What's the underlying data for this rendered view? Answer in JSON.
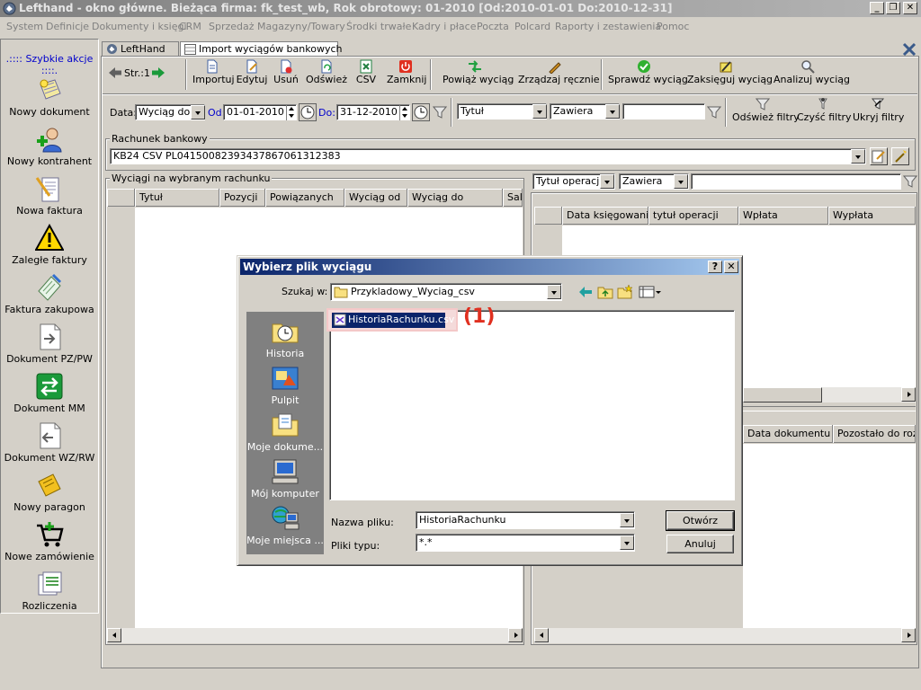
{
  "window": {
    "title": "Lefthand - okno główne. Bieżąca firma: fk_test_wb, Rok obrotowy: 01-2010 [Od:2010-01-01 Do:2010-12-31]",
    "minimize": "_",
    "maximize": "❐",
    "close": "✕"
  },
  "menu": [
    "System",
    "Definicje",
    "Dokumenty i księgi",
    "CRM",
    "Sprzedaż",
    "Magazyny/Towary",
    "Środki trwałe",
    "Kadry i płace",
    "Poczta",
    "Polcard",
    "Raporty i zestawienia",
    "Pomoc"
  ],
  "sidebar": {
    "header": ".:::: Szybkie akcje ::::.",
    "items": [
      {
        "label": "Nowy dokument",
        "icon": "new-document-icon"
      },
      {
        "label": "Nowy kontrahent",
        "icon": "new-contractor-icon"
      },
      {
        "label": "Nowa faktura",
        "icon": "new-invoice-icon"
      },
      {
        "label": "Zaległe faktury",
        "icon": "warning-icon"
      },
      {
        "label": "Faktura zakupowa",
        "icon": "purchase-invoice-icon"
      },
      {
        "label": "Dokument PZ/PW",
        "icon": "document-pz-icon"
      },
      {
        "label": "Dokument MM",
        "icon": "transfer-icon"
      },
      {
        "label": "Dokument WZ/RW",
        "icon": "document-wz-icon"
      },
      {
        "label": "Nowy paragon",
        "icon": "receipt-icon"
      },
      {
        "label": "Nowe zamówienie",
        "icon": "cart-icon"
      },
      {
        "label": "Rozliczenia",
        "icon": "settlements-icon"
      }
    ]
  },
  "tabs": [
    {
      "label": "LeftHand",
      "active": false
    },
    {
      "label": "Import wyciągów bankowych",
      "active": true
    }
  ],
  "toolbar": {
    "page_label": "Str.:1",
    "buttons": [
      "Importuj",
      "Edytuj",
      "Usuń",
      "Odśwież",
      "CSV",
      "Zamknij",
      "Powiąż wyciąg",
      "Zrządzaj ręcznie",
      "Sprawdź wyciąg",
      "Zaksięguj wyciąg",
      "Analizuj wyciąg"
    ]
  },
  "filterbar": {
    "date_label": "Data:",
    "date_field": "Wyciąg do",
    "from_label": "Od:",
    "from_value": "01-01-2010",
    "to_label": "Do:",
    "to_value": "31-12-2010",
    "field_select": "Tytuł",
    "op_select": "Zawiera",
    "filter_value": "",
    "refresh_filters": "Odśwież filtry",
    "clear_filters": "Czyść filtry",
    "hide_filters": "Ukryj filtry"
  },
  "account": {
    "group_label": "Rachunek bankowy",
    "value": "KB24 CSV PL04150082393437867061312383"
  },
  "statements": {
    "group_label": "Wyciągi na wybranym rachunku",
    "columns": [
      "Tytuł",
      "Pozycji",
      "Powiązanych",
      "Wyciąg od",
      "Wyciąg do",
      "Sal"
    ]
  },
  "operations": {
    "field_select": "Tytuł operacji",
    "op_select": "Zawiera",
    "columns": [
      "Data księgowania",
      "tytuł operacji",
      "Wpłata",
      "Wypłata"
    ],
    "columns2": [
      "Data dokumentu",
      "Pozostało do rozl"
    ]
  },
  "dialog": {
    "title": "Wybierz plik wyciągu",
    "help": "?",
    "close": "✕",
    "look_in_label": "Szukaj w:",
    "look_in_value": "Przykladowy_Wyciag_csv",
    "places": [
      "Historia",
      "Pulpit",
      "Moje dokume...",
      "Mój komputer",
      "Moje miejsca ..."
    ],
    "files": [
      "HistoriaRachunku.csv"
    ],
    "annotation": "(1)",
    "filename_label": "Nazwa pliku:",
    "filename_value": "HistoriaRachunku",
    "filetype_label": "Pliki typu:",
    "filetype_value": "*.*",
    "open_button": "Otwórz",
    "cancel_button": "Anuluj"
  }
}
